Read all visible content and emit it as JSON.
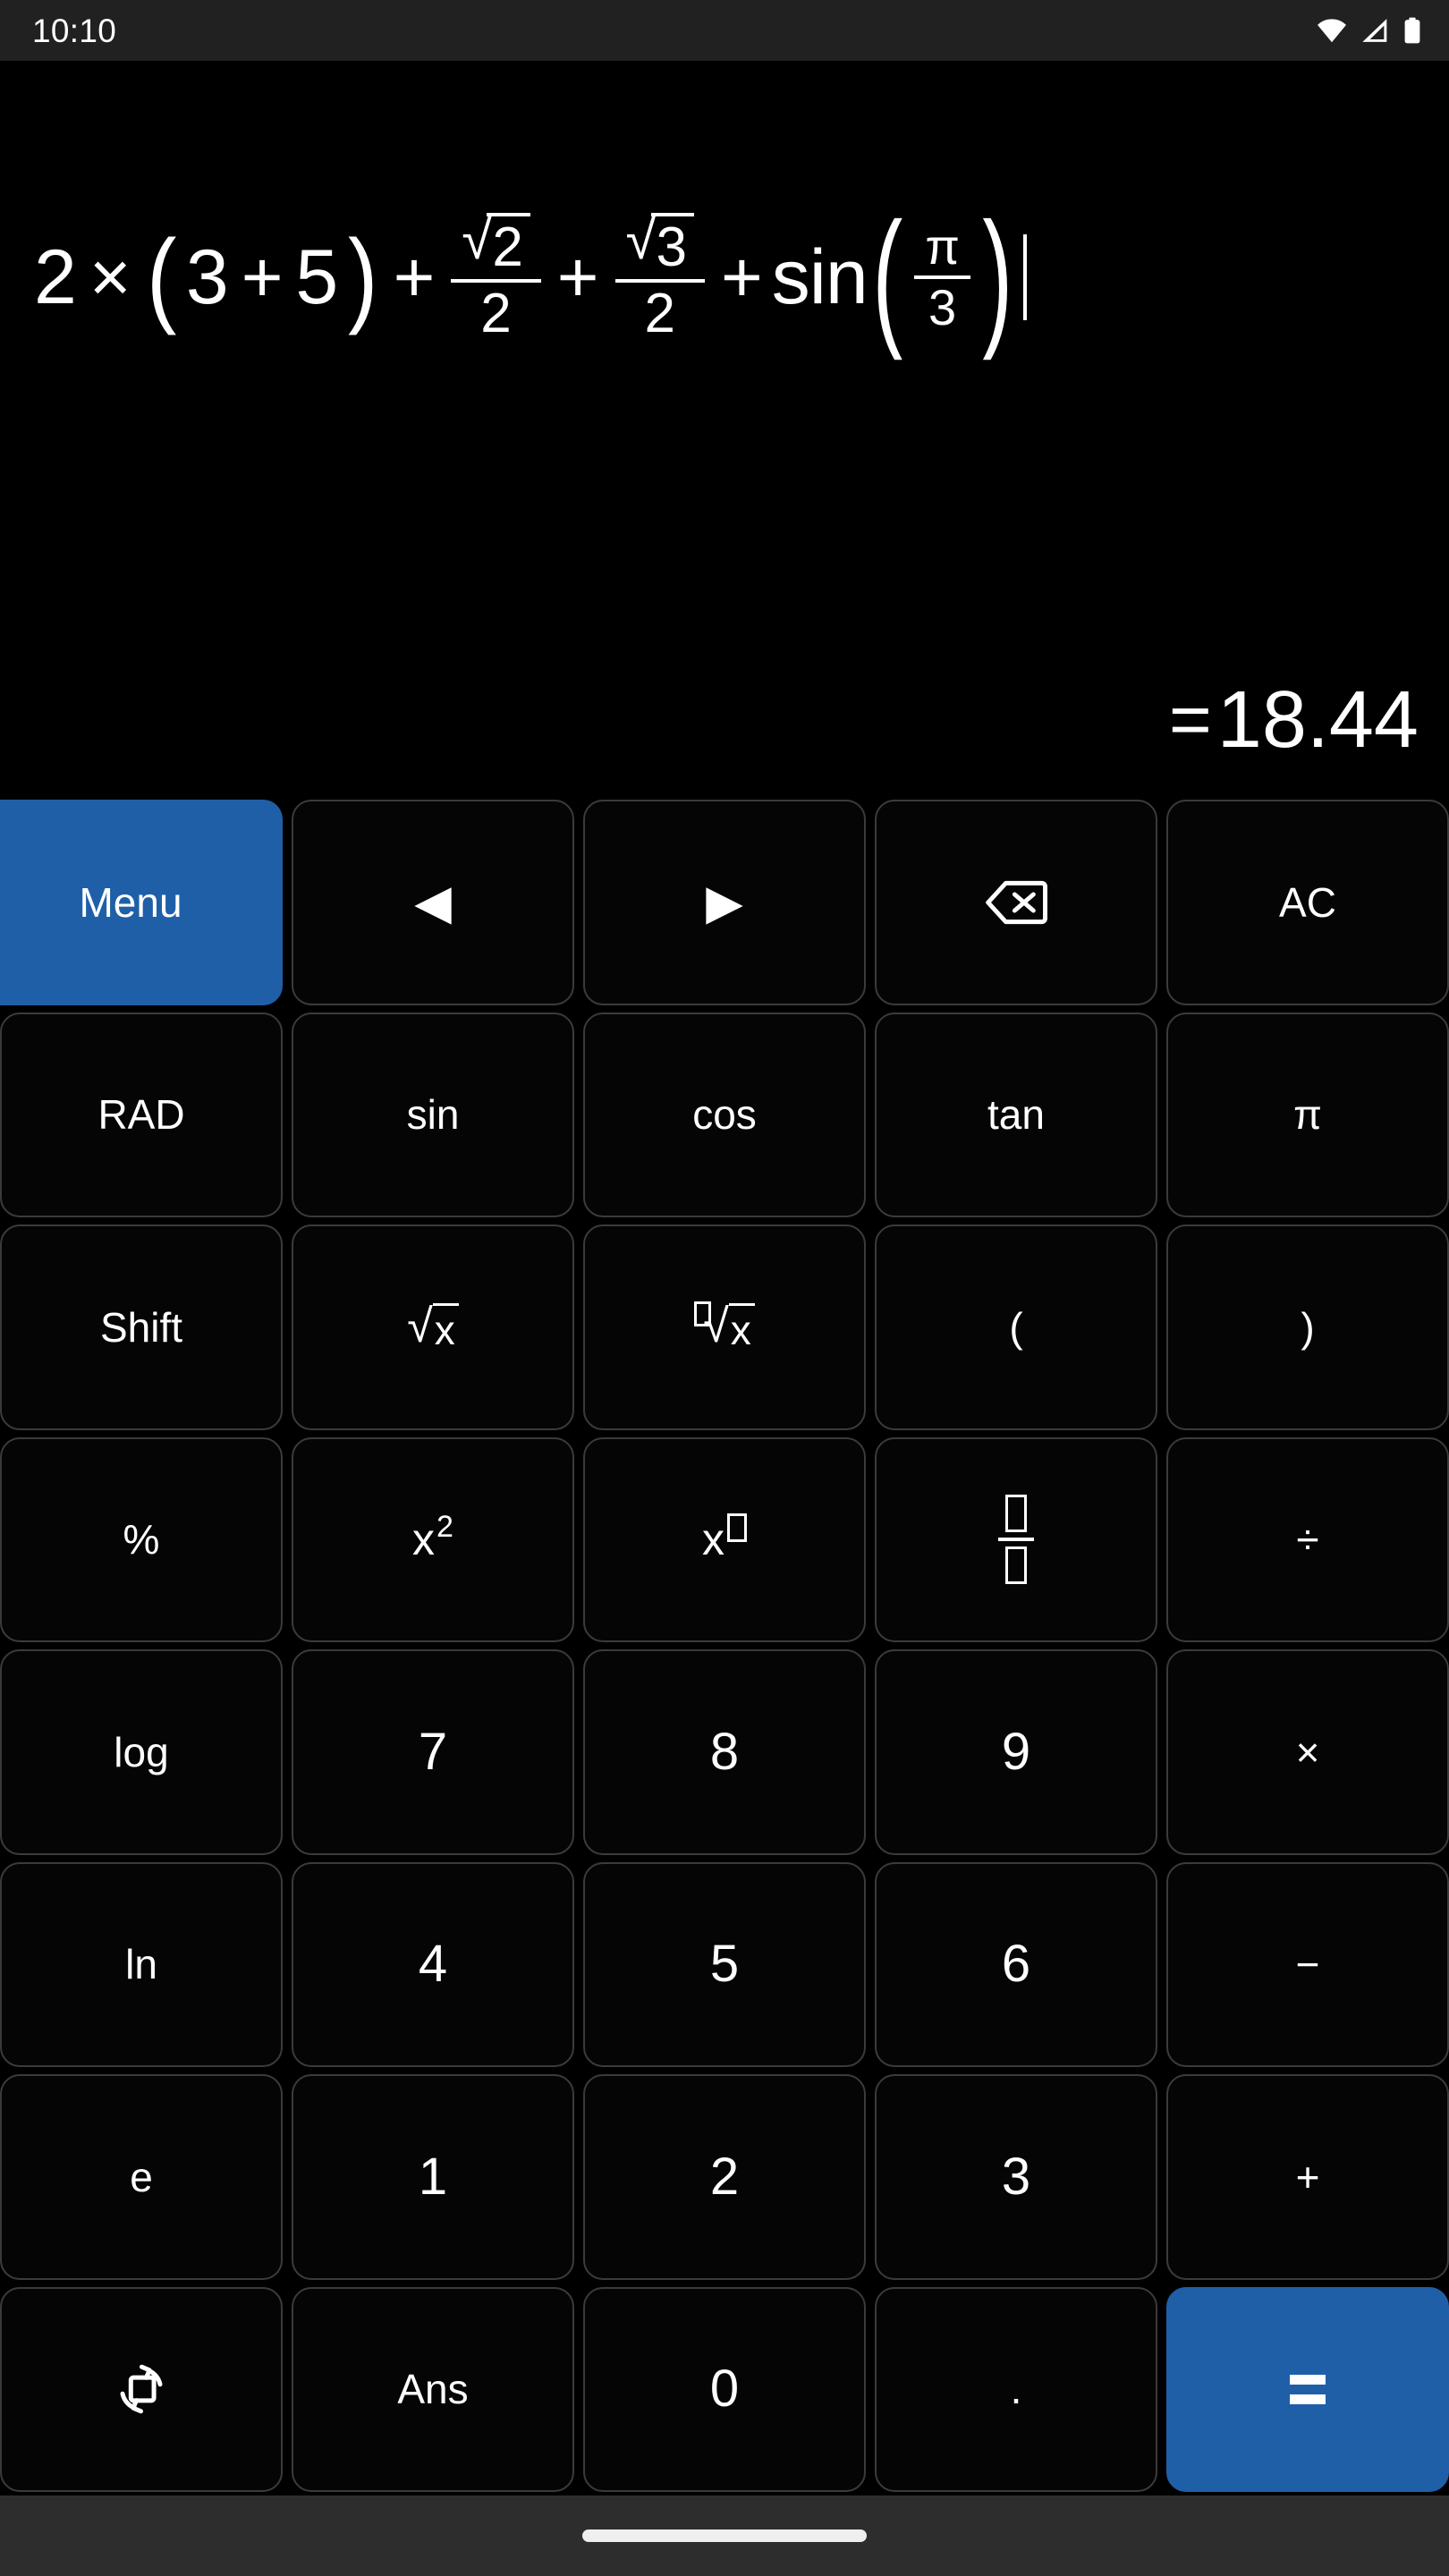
{
  "status_bar": {
    "time": "10:10",
    "icons": [
      "wifi-icon",
      "cellular-signal-icon",
      "battery-icon"
    ],
    "background": "#212121"
  },
  "display": {
    "expression_text": "2×(3+5)+√2/2+√3/2+sin(π/3)",
    "expression_tokens": {
      "t1": "2",
      "mul": "×",
      "lparen": "(",
      "t3": "3",
      "plus1": "+",
      "t5": "5",
      "rparen": ")",
      "plus2": "+",
      "frac1_num_radical": "√",
      "frac1_num_radicand": "2",
      "frac1_den": "2",
      "plus3": "+",
      "frac2_num_radical": "√",
      "frac2_num_radicand": "3",
      "frac2_den": "2",
      "plus4": "+",
      "fn": "sin",
      "fn_lparen": "(",
      "fn_frac_num": "π",
      "fn_frac_den": "3",
      "fn_rparen": ")"
    },
    "result_equals": "=",
    "result_value": "18.44",
    "cursor_visible": true
  },
  "keypad": {
    "accent_color": "#1f5fa8",
    "key_border_color": "#3b3b3b",
    "rows": [
      [
        {
          "name": "menu-button",
          "label": "Menu",
          "kind": "text",
          "accent": true
        },
        {
          "name": "cursor-left-button",
          "label": "◀",
          "kind": "glyph"
        },
        {
          "name": "cursor-right-button",
          "label": "▶",
          "kind": "glyph"
        },
        {
          "name": "backspace-button",
          "label": "backspace-icon",
          "kind": "icon"
        },
        {
          "name": "all-clear-button",
          "label": "AC",
          "kind": "text"
        }
      ],
      [
        {
          "name": "angle-mode-button",
          "label": "RAD",
          "kind": "text"
        },
        {
          "name": "sin-button",
          "label": "sin",
          "kind": "text"
        },
        {
          "name": "cos-button",
          "label": "cos",
          "kind": "text"
        },
        {
          "name": "tan-button",
          "label": "tan",
          "kind": "text"
        },
        {
          "name": "pi-button",
          "label": "π",
          "kind": "text"
        }
      ],
      [
        {
          "name": "shift-button",
          "label": "Shift",
          "kind": "text"
        },
        {
          "name": "square-root-button",
          "label": "√x",
          "kind": "radical",
          "radicand": "x"
        },
        {
          "name": "nth-root-button",
          "label": "ⁿ√x",
          "kind": "nth-root",
          "radicand": "x"
        },
        {
          "name": "open-paren-button",
          "label": "(",
          "kind": "text"
        },
        {
          "name": "close-paren-button",
          "label": ")",
          "kind": "text"
        }
      ],
      [
        {
          "name": "percent-button",
          "label": "%",
          "kind": "text"
        },
        {
          "name": "square-button",
          "label": "x²",
          "kind": "power",
          "base": "x",
          "sup": "2"
        },
        {
          "name": "power-button",
          "label": "x^□",
          "kind": "power-box",
          "base": "x"
        },
        {
          "name": "fraction-button",
          "label": "□/□",
          "kind": "fraction"
        },
        {
          "name": "divide-button",
          "label": "÷",
          "kind": "text"
        }
      ],
      [
        {
          "name": "log-button",
          "label": "log",
          "kind": "text"
        },
        {
          "name": "digit-7-button",
          "label": "7",
          "kind": "digit"
        },
        {
          "name": "digit-8-button",
          "label": "8",
          "kind": "digit"
        },
        {
          "name": "digit-9-button",
          "label": "9",
          "kind": "digit"
        },
        {
          "name": "multiply-button",
          "label": "×",
          "kind": "text"
        }
      ],
      [
        {
          "name": "ln-button",
          "label": "ln",
          "kind": "text"
        },
        {
          "name": "digit-4-button",
          "label": "4",
          "kind": "digit"
        },
        {
          "name": "digit-5-button",
          "label": "5",
          "kind": "digit"
        },
        {
          "name": "digit-6-button",
          "label": "6",
          "kind": "digit"
        },
        {
          "name": "minus-button",
          "label": "−",
          "kind": "text"
        }
      ],
      [
        {
          "name": "euler-button",
          "label": "e",
          "kind": "text"
        },
        {
          "name": "digit-1-button",
          "label": "1",
          "kind": "digit"
        },
        {
          "name": "digit-2-button",
          "label": "2",
          "kind": "digit"
        },
        {
          "name": "digit-3-button",
          "label": "3",
          "kind": "digit"
        },
        {
          "name": "plus-button",
          "label": "+",
          "kind": "text"
        }
      ],
      [
        {
          "name": "screen-rotation-button",
          "label": "screen-rotation-icon",
          "kind": "icon"
        },
        {
          "name": "answer-button",
          "label": "Ans",
          "kind": "text"
        },
        {
          "name": "digit-0-button",
          "label": "0",
          "kind": "digit"
        },
        {
          "name": "decimal-point-button",
          "label": ".",
          "kind": "text"
        },
        {
          "name": "equals-button",
          "label": "=",
          "kind": "equals",
          "accent": true
        }
      ]
    ]
  },
  "nav_bar": {
    "type": "gesture-pill",
    "background": "#2d2d2d"
  }
}
